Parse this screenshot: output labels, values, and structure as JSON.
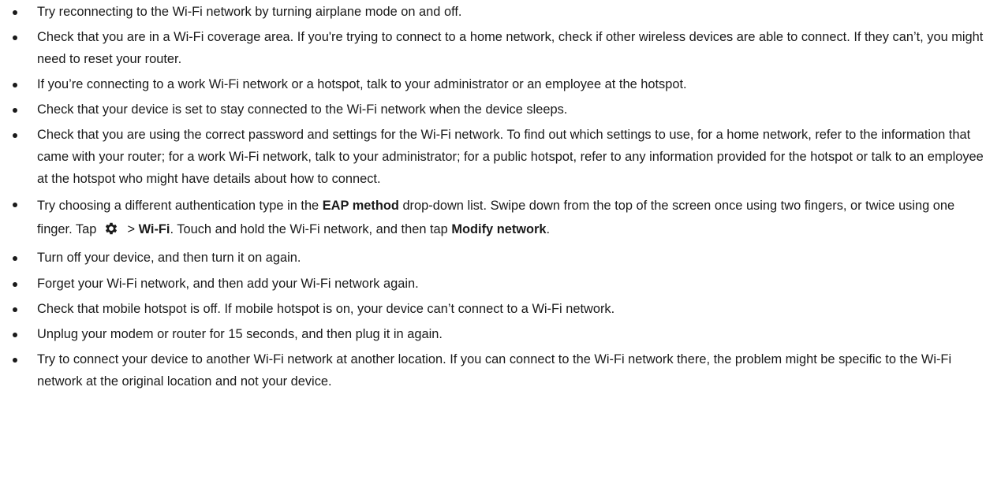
{
  "tips": [
    {
      "text": "Try reconnecting to the Wi-Fi network by turning airplane mode on and off."
    },
    {
      "text": "Check that you are in a Wi-Fi coverage area. If you're trying to connect to a home network, check if other wireless devices are able to connect. If they can’t, you might need to reset your router."
    },
    {
      "text": "If you’re connecting to a work Wi-Fi network or a hotspot, talk to your administrator or an employee at the hotspot."
    },
    {
      "text": "Check that your device is set to stay connected to the Wi-Fi network when the device sleeps."
    },
    {
      "text": "Check that you are using the correct password and settings for the Wi-Fi network. To find out which settings to use, for a home network, refer to the information that came with your router; for a work Wi-Fi network, talk to your administrator; for a public hotspot, refer to any information provided for the hotspot or talk to an employee at the hotspot who might have details about how to connect."
    },
    {
      "part1": "Try choosing a different authentication type in the ",
      "bold1": "EAP method",
      "part2": " drop-down list. Swipe down from the top of the screen once using two fingers, or twice using one finger. Tap ",
      "icon": "settings-gear-icon",
      "part3": " > ",
      "bold2": "Wi-Fi",
      "part4": ". Touch and hold the Wi-Fi network, and then tap ",
      "bold3": "Modify network",
      "part5": "."
    },
    {
      "text": "Turn off your device, and then turn it on again."
    },
    {
      "text": "Forget your Wi-Fi network, and then add your Wi-Fi network again."
    },
    {
      "text": "Check that mobile hotspot is off. If mobile hotspot is on, your device can’t connect to a Wi-Fi network."
    },
    {
      "text": "Unplug your modem or router for 15 seconds, and then plug it in again."
    },
    {
      "text": "Try to connect your device to another Wi-Fi network at another location. If you can connect to the Wi-Fi network there, the problem might be specific to the Wi-Fi network at the original location and not your device."
    }
  ]
}
